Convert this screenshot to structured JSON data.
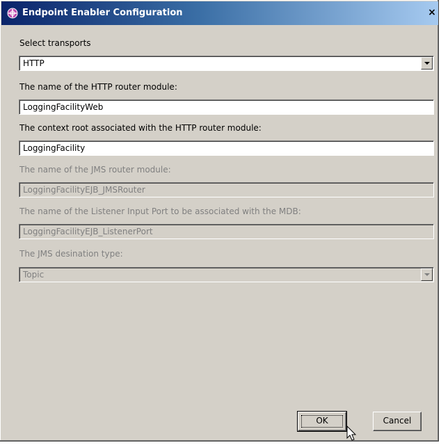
{
  "window": {
    "title": "Endpoint Enabler Configuration",
    "close_glyph": "×"
  },
  "form": {
    "transports_label": "Select transports",
    "transports_value": "HTTP",
    "http_router_label": "The name of the HTTP router module:",
    "http_router_value": "LoggingFacilityWeb",
    "context_root_label": "The context root associated with the HTTP router module:",
    "context_root_value": "LoggingFacility",
    "jms_router_label": "The name of the JMS router module:",
    "jms_router_value": "LoggingFacilityEJB_JMSRouter",
    "listener_port_label": "The name of the Listener Input Port to be associated with the MDB:",
    "listener_port_value": "LoggingFacilityEJB_ListenerPort",
    "jms_dest_label": "The JMS desination type:",
    "jms_dest_value": "Topic"
  },
  "buttons": {
    "ok": "OK",
    "cancel": "Cancel"
  },
  "icons": {
    "title": "app-globe-icon",
    "close": "close-icon",
    "dropdown": "chevron-down-icon",
    "cursor": "mouse-pointer-icon"
  },
  "colors": {
    "dialog_bg": "#d4d0c8",
    "title_start": "#0a246a",
    "title_end": "#a6caf0",
    "disabled_text": "#808080"
  }
}
